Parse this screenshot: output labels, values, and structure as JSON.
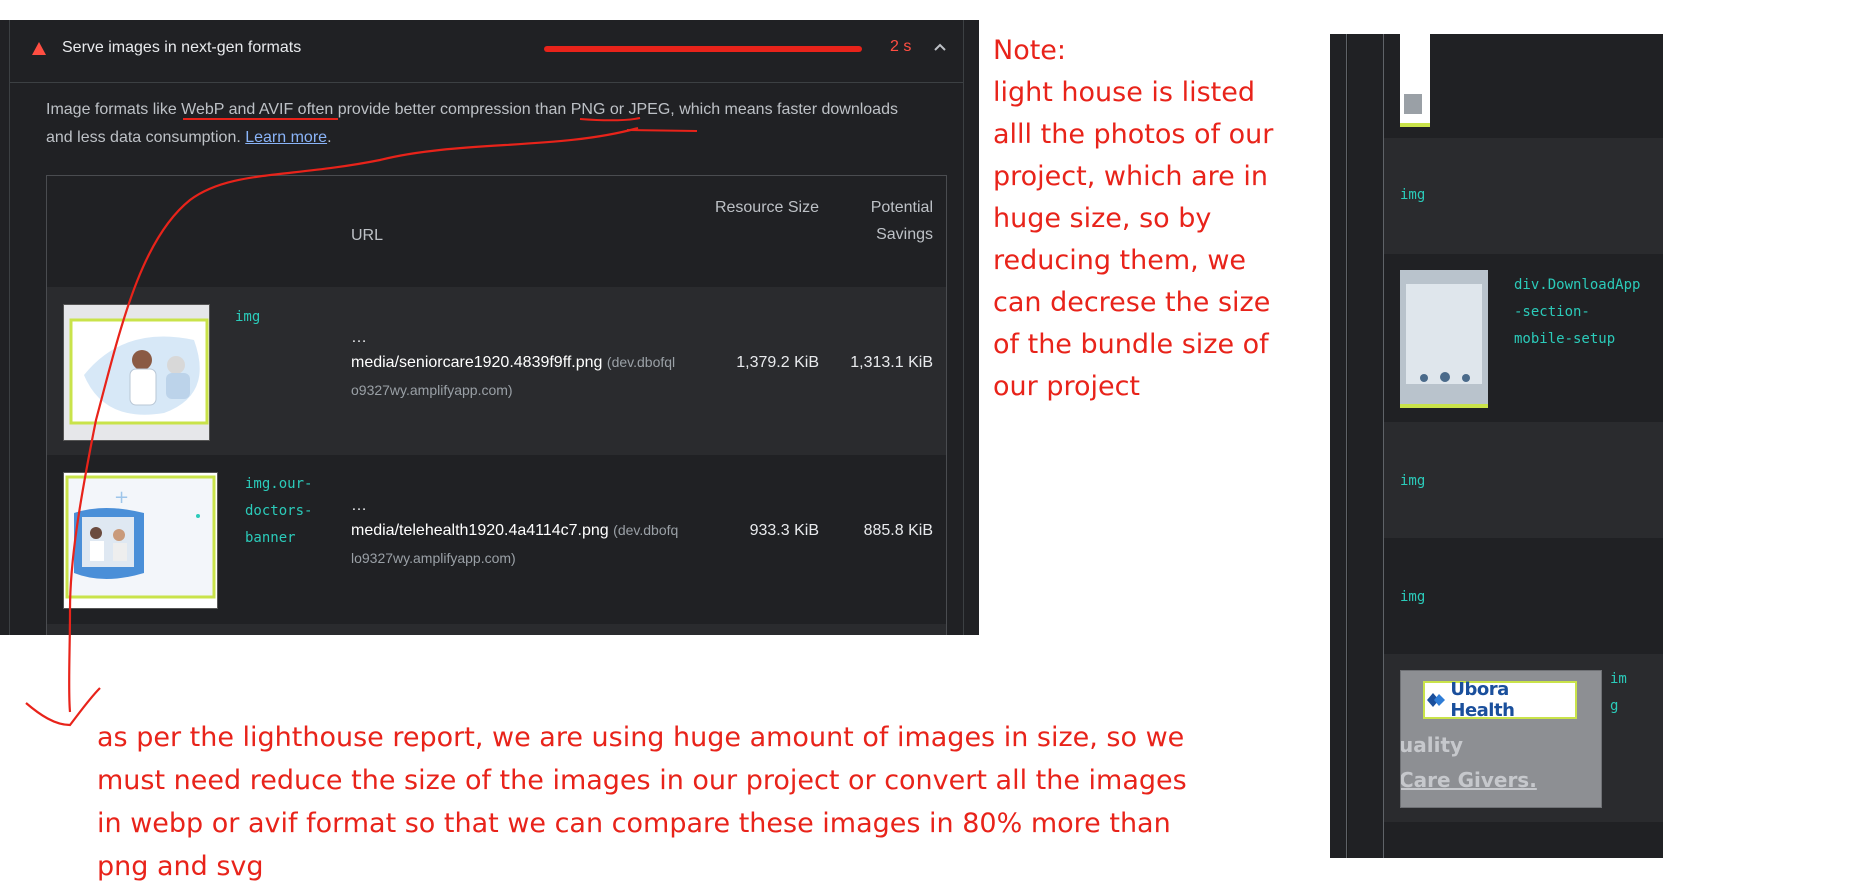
{
  "audit": {
    "title": "Serve images in next-gen formats",
    "savings_time": "2 s",
    "savings_fraction": 1.0,
    "description_pre": "Image formats like WebP and AVIF often provide better compression than PNG or JPEG, which means faster downloads and less data consumption. ",
    "learn_more": "Learn more",
    "description_end": "."
  },
  "table": {
    "headers": {
      "url": "URL",
      "resource_size": "Resource Size",
      "potential_savings": "Potential Savings"
    },
    "rows": [
      {
        "node": "img",
        "ellipsis": "…",
        "url_path": "media/seniorcare1920.4839f9ff.png",
        "url_host_a": "(dev.dbofql",
        "url_host_b": "o9327wy.amplifyapp.com)",
        "resource_size": "1,379.2 KiB",
        "potential_savings": "1,313.1 KiB"
      },
      {
        "node": "img.our-\ndoctors-\nbanner",
        "ellipsis": "…",
        "url_path": "media/telehealth1920.4a4114c7.png",
        "url_host_a": "(dev.dbofq",
        "url_host_b": "lo9327wy.amplifyapp.com)",
        "resource_size": "933.3 KiB",
        "potential_savings": "885.8 KiB"
      }
    ]
  },
  "notes": {
    "side": "Note:\nlight house is listed alll the photos of our project, which are in huge size, so by reducing them, we can decrese the size of the bundle size of our project",
    "bottom": "as per the lighthouse report, we are using huge amount of images in size, so we must need reduce the size of the images in our project or convert all the images in webp or avif format so that we can compare these images in 80% more than png and svg"
  },
  "side_panel": {
    "rows": [
      {
        "node": "img"
      },
      {
        "node": "div.DownloadApp\n-section-\nmobile-setup"
      },
      {
        "node": "img"
      },
      {
        "node": "img"
      },
      {
        "node": "im\ng",
        "logo_text": "Ubora Health",
        "partial_text_1": "uality",
        "partial_text_2": "Care Givers."
      }
    ]
  },
  "colors": {
    "annotation": "#e8231a",
    "warning": "#ff4e42",
    "node_tag": "#2bcbba",
    "panel_bg": "#202124"
  }
}
